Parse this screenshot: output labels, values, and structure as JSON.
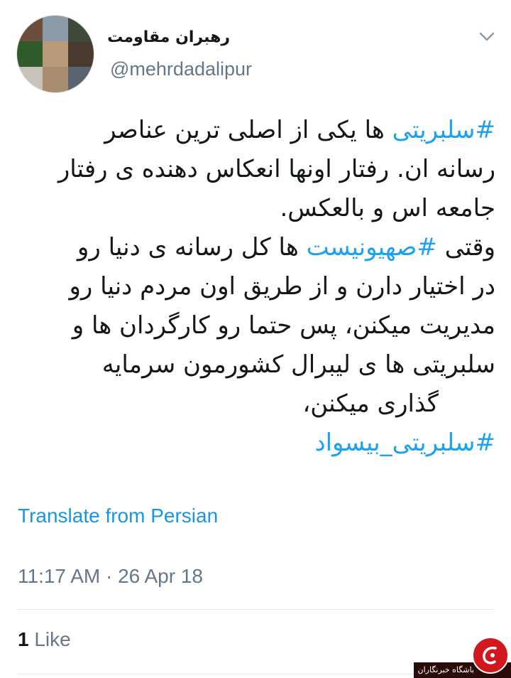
{
  "tweet": {
    "author": {
      "display_name": "رهبران مقاومت",
      "handle": "@mehrdadalipur",
      "avatar_palette": [
        "#6b4e3d",
        "#8a9aa6",
        "#3f4a3a",
        "#2f5a2a",
        "#b89a7a",
        "#4a3a30",
        "#c9c2b8",
        "#a88c6e",
        "#5a6470"
      ]
    },
    "body": {
      "line1_hashtag": "#سلبریتی",
      "line1_rest": " ها یکی از اصلی ترین عناصر",
      "line2": "رسانه ان. رفتار اونها انعکاس دهنده ی رفتار",
      "line3": "جامعه اس و بالعکس.",
      "line4_start": "وقتی ",
      "line4_hashtag": "#صهیونیست",
      "line4_rest": " ها کل رسانه ی دنیا رو",
      "line5": "در اختیار دارن و از طریق اون مردم دنیا رو",
      "line6": "مدیریت میکنن، پس حتما رو کارگردان ها و",
      "line7": "سلبریتی ها ی لیبرال کشورمون سرمایه",
      "line8": "گذاری میکنن،",
      "line9_hashtag": "#سلبریتی_بیسواد"
    },
    "translate_label": "Translate from Persian",
    "timestamp": "11:17 AM · 26 Apr 18",
    "likes": {
      "count": "1",
      "label": "Like"
    }
  },
  "watermark": {
    "text": "باشگاه خبرنگاران"
  },
  "colors": {
    "hashtag": "#1da1f2",
    "link": "#1b95e0",
    "muted": "#657786",
    "divider": "#e1e8ed"
  }
}
